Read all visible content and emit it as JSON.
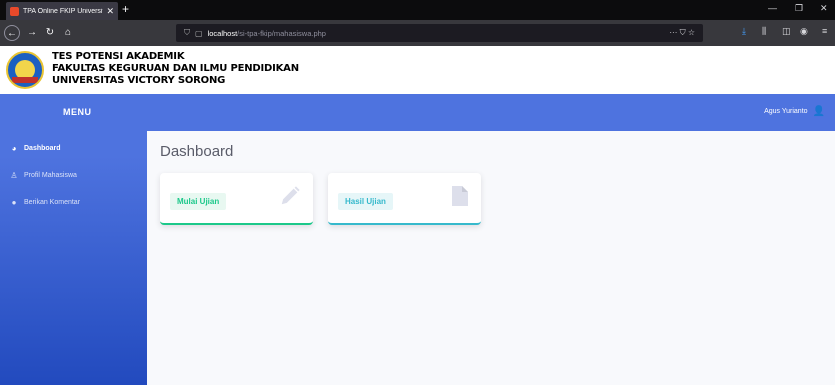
{
  "browser": {
    "tab_title": "TPA Online FKIP Universitas Vi...",
    "tab_close": "✕",
    "new_tab": "+",
    "url_host": "localhost",
    "url_path": "/si-tpa-fkip/mahasiswa.php",
    "url_actions": "··· ⛉ ☆",
    "window_minimize": "—",
    "window_restore": "❐",
    "window_close": "✕"
  },
  "header": {
    "line1": "TES POTENSI AKADEMIK",
    "line2": "FAKULTAS KEGURUAN DAN ILMU PENDIDIKAN",
    "line3": "UNIVERSITAS VICTORY SORONG"
  },
  "topbar": {
    "menu_title": "MENU",
    "user_name": "Agus Yurianto"
  },
  "sidebar": {
    "items": [
      {
        "label": "Dashboard",
        "icon": "tachometer-icon",
        "active": true
      },
      {
        "label": "Profil Mahasiswa",
        "icon": "user-icon",
        "active": false
      },
      {
        "label": "Berikan Komentar",
        "icon": "comment-icon",
        "active": false
      }
    ]
  },
  "main": {
    "title": "Dashboard",
    "cards": [
      {
        "label": "Mulai Ujian",
        "icon": "pencil-icon",
        "accent": "#1cc88a"
      },
      {
        "label": "Hasil Ujian",
        "icon": "file-icon",
        "accent": "#36b9cc"
      }
    ]
  },
  "colors": {
    "primary": "#4e73df",
    "success": "#1cc88a",
    "info": "#36b9cc"
  }
}
